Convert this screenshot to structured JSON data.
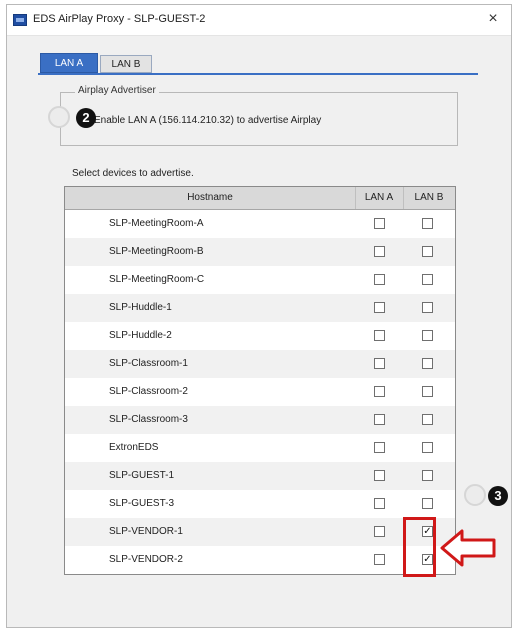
{
  "window": {
    "title": "EDS AirPlay Proxy - SLP-GUEST-2",
    "close_glyph": "×"
  },
  "tabs": [
    {
      "label": "LAN A",
      "active": true
    },
    {
      "label": "LAN B",
      "active": false
    }
  ],
  "advertiser": {
    "legend": "Airplay Advertiser",
    "enable_label": "Enable LAN A (156.114.210.32) to advertise Airplay",
    "enabled": false
  },
  "callouts": {
    "two": "2",
    "three": "3"
  },
  "devices": {
    "label": "Select devices to advertise.",
    "columns": [
      "Hostname",
      "LAN A",
      "LAN B"
    ],
    "rows": [
      {
        "hostname": "SLP-MeetingRoom-A",
        "lan_a": false,
        "lan_b": false
      },
      {
        "hostname": "SLP-MeetingRoom-B",
        "lan_a": false,
        "lan_b": false
      },
      {
        "hostname": "SLP-MeetingRoom-C",
        "lan_a": false,
        "lan_b": false
      },
      {
        "hostname": "SLP-Huddle-1",
        "lan_a": false,
        "lan_b": false
      },
      {
        "hostname": "SLP-Huddle-2",
        "lan_a": false,
        "lan_b": false
      },
      {
        "hostname": "SLP-Classroom-1",
        "lan_a": false,
        "lan_b": false
      },
      {
        "hostname": "SLP-Classroom-2",
        "lan_a": false,
        "lan_b": false
      },
      {
        "hostname": "SLP-Classroom-3",
        "lan_a": false,
        "lan_b": false
      },
      {
        "hostname": "ExtronEDS",
        "lan_a": false,
        "lan_b": false
      },
      {
        "hostname": "SLP-GUEST-1",
        "lan_a": false,
        "lan_b": false
      },
      {
        "hostname": "SLP-GUEST-3",
        "lan_a": false,
        "lan_b": false
      },
      {
        "hostname": "SLP-VENDOR-1",
        "lan_a": false,
        "lan_b": true
      },
      {
        "hostname": "SLP-VENDOR-2",
        "lan_a": false,
        "lan_b": true
      }
    ]
  },
  "colors": {
    "accent": "#3a6fc4",
    "highlight": "#d01818"
  }
}
